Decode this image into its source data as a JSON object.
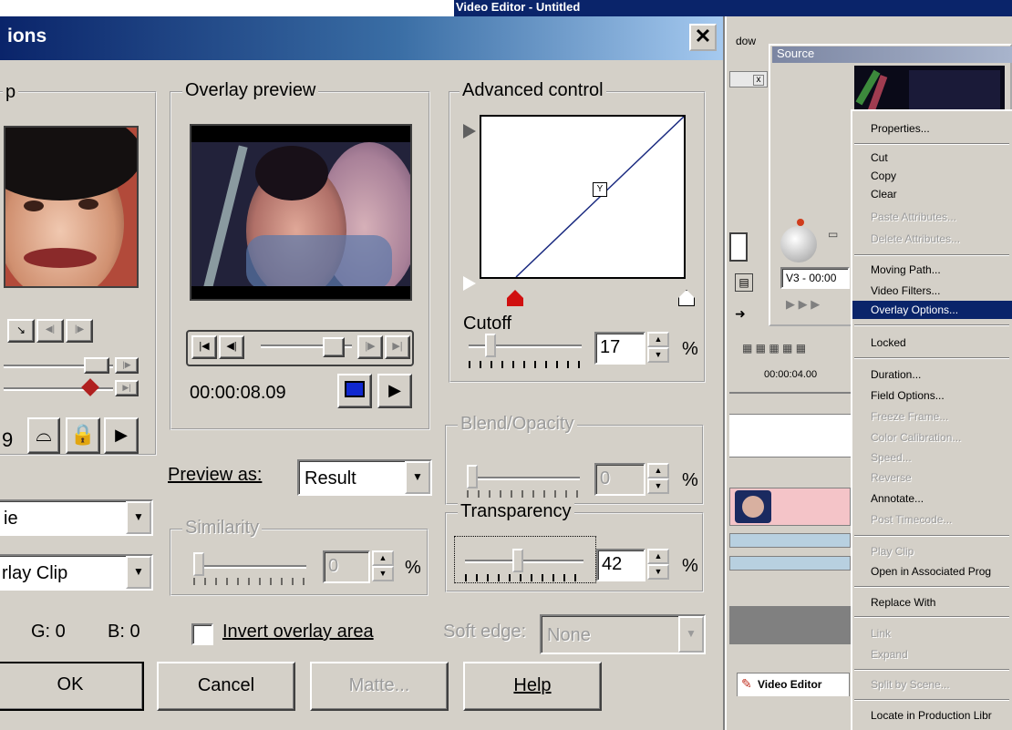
{
  "dialog": {
    "title": "ions",
    "close_label": "✕",
    "left_group_label": "p",
    "left_counter": "9",
    "overlay_preview_label": "Overlay preview",
    "timecode": "00:00:08.09",
    "advanced_label": "Advanced control",
    "cutoff_label": "Cutoff",
    "cutoff_value": "17",
    "percent": "%",
    "preview_as_label": "Preview as:",
    "preview_as_value": "Result",
    "blend_label": "Blend/Opacity",
    "blend_value": "0",
    "similarity_label": "Similarity",
    "similarity_value": "0",
    "transparency_label": "Transparency",
    "transparency_value": "42",
    "combo1_value": "ie",
    "combo2_value": "rlay Clip",
    "color_g": "G: 0",
    "color_b": "B: 0",
    "invert_label": "Invert overlay area",
    "soft_edge_label": "Soft edge:",
    "soft_edge_value": "None",
    "ok_label": "OK",
    "cancel_label": "Cancel",
    "matte_label": "Matte...",
    "help_label": "Help"
  },
  "app": {
    "title": "Video Editor - Untitled",
    "menu_frag": "dow",
    "source_title": "Source",
    "timecode_field": "V3 - 00:00",
    "ruler_time": "00:00:04.00",
    "video_editor_tab": "Video Editor"
  },
  "context_menu": {
    "items": [
      {
        "label": "Properties...",
        "state": "normal"
      },
      {
        "label": "Cut",
        "state": "normal"
      },
      {
        "label": "Copy",
        "state": "normal"
      },
      {
        "label": "Clear",
        "state": "normal"
      },
      {
        "label": "Paste Attributes...",
        "state": "disabled"
      },
      {
        "label": "Delete Attributes...",
        "state": "disabled"
      },
      {
        "label": "Moving Path...",
        "state": "normal"
      },
      {
        "label": "Video Filters...",
        "state": "normal"
      },
      {
        "label": "Overlay Options...",
        "state": "selected"
      },
      {
        "label": "Locked",
        "state": "normal"
      },
      {
        "label": "Duration...",
        "state": "normal"
      },
      {
        "label": "Field Options...",
        "state": "normal"
      },
      {
        "label": "Freeze Frame...",
        "state": "disabled"
      },
      {
        "label": "Color Calibration...",
        "state": "disabled"
      },
      {
        "label": "Speed...",
        "state": "disabled"
      },
      {
        "label": "Reverse",
        "state": "disabled"
      },
      {
        "label": "Annotate...",
        "state": "normal"
      },
      {
        "label": "Post Timecode...",
        "state": "disabled"
      },
      {
        "label": "Play Clip",
        "state": "disabled"
      },
      {
        "label": "Open in Associated Prog",
        "state": "normal"
      },
      {
        "label": "Replace With",
        "state": "normal"
      },
      {
        "label": "Link",
        "state": "disabled"
      },
      {
        "label": "Expand",
        "state": "disabled"
      },
      {
        "label": "Split by Scene...",
        "state": "disabled"
      },
      {
        "label": "Locate in Production Libr",
        "state": "normal"
      }
    ]
  }
}
